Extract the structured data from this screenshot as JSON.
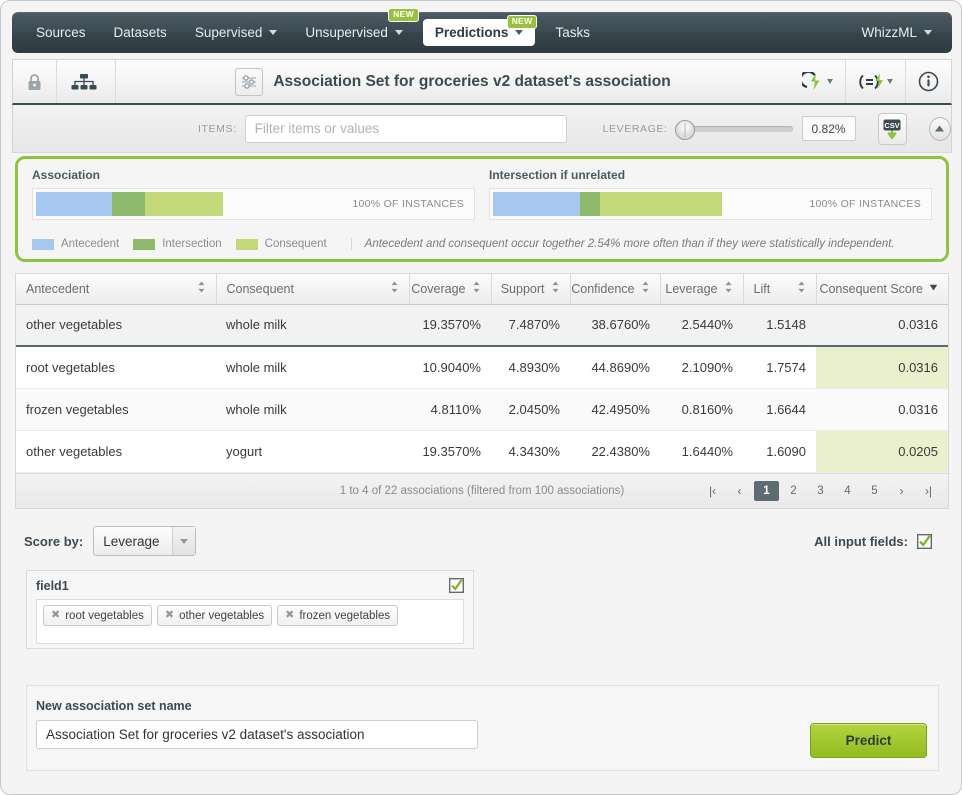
{
  "nav": {
    "items": [
      {
        "label": "Sources",
        "caret": false,
        "badge": null,
        "active": false
      },
      {
        "label": "Datasets",
        "caret": false,
        "badge": null,
        "active": false
      },
      {
        "label": "Supervised",
        "caret": true,
        "badge": null,
        "active": false
      },
      {
        "label": "Unsupervised",
        "caret": true,
        "badge": "NEW",
        "active": false
      },
      {
        "label": "Predictions",
        "caret": true,
        "badge": "NEW",
        "active": true
      },
      {
        "label": "Tasks",
        "caret": false,
        "badge": null,
        "active": false
      }
    ],
    "account": "WhizzML"
  },
  "header": {
    "title": "Association Set for groceries v2 dataset's association",
    "lock_icon": "lock-icon",
    "tree_icon": "model-tree-icon",
    "config_icon": "sliders-icon",
    "action_icons": [
      "lightning-refresh-icon",
      "equals-lightning-icon",
      "info-icon"
    ]
  },
  "filterbar": {
    "items_label": "ITEMS:",
    "items_placeholder": "Filter items or values",
    "items_value": "",
    "leverage_label": "LEVERAGE:",
    "leverage_value": "0.82%",
    "csv_label": "CSV",
    "collapse_icon": "collapse-up-icon"
  },
  "assoc": {
    "left_title": "Association",
    "right_title": "Intersection if unrelated",
    "instances_label": "100% OF INSTANCES",
    "left_bar": {
      "antecedent_pct": 17.0,
      "intersection_pct": 7.5,
      "consequent_pct": 17.5
    },
    "right_bar": {
      "antecedent_pct": 19.5,
      "intersection_pct": 4.5,
      "consequent_pct": 27.5
    },
    "legend": [
      {
        "label": "Antecedent",
        "color": "#a6c8f0"
      },
      {
        "label": "Intersection",
        "color": "#8fba6c"
      },
      {
        "label": "Consequent",
        "color": "#c3d878"
      }
    ],
    "note": "Antecedent and consequent occur together 2.54% more often than if they were statistically independent."
  },
  "table": {
    "columns": [
      {
        "label": "Antecedent",
        "numeric": false,
        "sort": "both"
      },
      {
        "label": "Consequent",
        "numeric": false,
        "sort": "both"
      },
      {
        "label": "Coverage",
        "numeric": true,
        "sort": "both"
      },
      {
        "label": "Support",
        "numeric": true,
        "sort": "both"
      },
      {
        "label": "Confidence",
        "numeric": true,
        "sort": "both"
      },
      {
        "label": "Leverage",
        "numeric": true,
        "sort": "both"
      },
      {
        "label": "Lift",
        "numeric": true,
        "sort": "both"
      },
      {
        "label": "Consequent Score",
        "numeric": true,
        "sort": "desc"
      }
    ],
    "rows": [
      {
        "antecedent": "other vegetables",
        "consequent": "whole milk",
        "coverage": "19.3570%",
        "support": "7.4870%",
        "confidence": "38.6760%",
        "leverage": "2.5440%",
        "lift": "1.5148",
        "score": "0.0316"
      },
      {
        "antecedent": "root vegetables",
        "consequent": "whole milk",
        "coverage": "10.9040%",
        "support": "4.8930%",
        "confidence": "44.8690%",
        "leverage": "2.1090%",
        "lift": "1.7574",
        "score": "0.0316"
      },
      {
        "antecedent": "frozen vegetables",
        "consequent": "whole milk",
        "coverage": "4.8110%",
        "support": "2.0450%",
        "confidence": "42.4950%",
        "leverage": "0.8160%",
        "lift": "1.6644",
        "score": "0.0316"
      },
      {
        "antecedent": "other vegetables",
        "consequent": "yogurt",
        "coverage": "19.3570%",
        "support": "4.3430%",
        "confidence": "22.4380%",
        "leverage": "1.6440%",
        "lift": "1.6090",
        "score": "0.0205"
      }
    ],
    "footer_text": "1 to 4 of 22 associations (filtered from 100 associations)",
    "pages": [
      "1",
      "2",
      "3",
      "4",
      "5"
    ],
    "current_page": "1"
  },
  "controls": {
    "scoreby_label": "Score by:",
    "scoreby_value": "Leverage",
    "allfields_label": "All input fields:",
    "allfields_checked": true,
    "field_title": "field1",
    "field_checked": true,
    "tags": [
      "root vegetables",
      "other vegetables",
      "frozen vegetables"
    ]
  },
  "bottom": {
    "name_label": "New association set name",
    "name_value": "Association Set for groceries v2 dataset's association",
    "predict_label": "Predict"
  },
  "colors": {
    "accent_green": "#8cc63e",
    "nav_dark": "#3c4a52",
    "score_cell": "#eaf0cd",
    "antecedent": "#a6c8f0",
    "intersection": "#8fba6c",
    "consequent": "#c3d878"
  }
}
